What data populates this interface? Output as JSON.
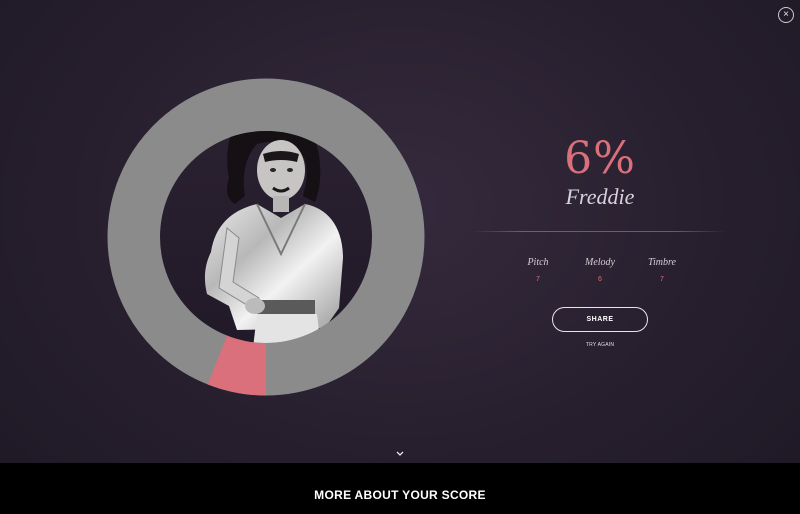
{
  "close_button": {
    "icon": "close-icon",
    "glyph": "×"
  },
  "result": {
    "percent": "6%",
    "percent_value": 6,
    "artist": "Freddie",
    "metrics": [
      {
        "label": "Pitch",
        "value": "7"
      },
      {
        "label": "Melody",
        "value": "6"
      },
      {
        "label": "Timbre",
        "value": "7"
      }
    ]
  },
  "actions": {
    "share_label": "SHARE",
    "try_again_label": "TRY AGAIN"
  },
  "footer": {
    "more_label": "MORE ABOUT YOUR SCORE",
    "chevron_icon": "chevron-down-icon"
  },
  "colors": {
    "accent": "#d9707c",
    "ring_track": "#8b8b8b",
    "background": "#271f2e"
  }
}
